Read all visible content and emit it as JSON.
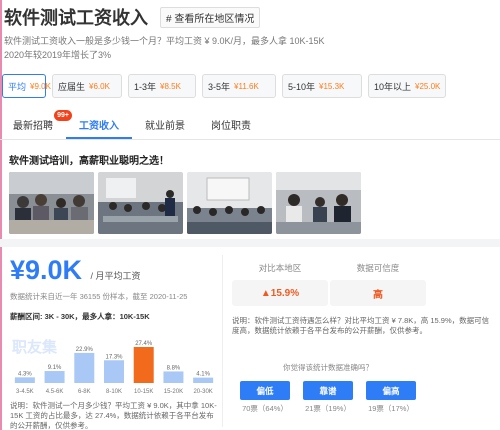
{
  "header": {
    "title": "软件测试工资收入",
    "region_button": "# 查看所在地区情况",
    "summary": "软件测试工资收入一般是多少钱一个月？平均工资 ¥ 9.0K/月，最多人拿 10K-15K",
    "growth": "2020年较2019年增长了3%"
  },
  "filters": [
    {
      "label": "平均",
      "value": "¥9.0K",
      "active": true
    },
    {
      "label": "应届生",
      "value": "¥6.0K"
    },
    {
      "label": "1-3年",
      "value": "¥8.5K"
    },
    {
      "label": "3-5年",
      "value": "¥11.6K"
    },
    {
      "label": "5-10年",
      "value": "¥15.3K"
    },
    {
      "label": "10年以上",
      "value": "¥25.0K"
    }
  ],
  "tabs": [
    {
      "label": "最新招聘",
      "badge": "99+"
    },
    {
      "label": "工资收入",
      "active": true
    },
    {
      "label": "就业前景"
    },
    {
      "label": "岗位职责"
    }
  ],
  "promo": {
    "title": "软件测试培训，高薪职业聪明之选！"
  },
  "salary": {
    "amount": "¥9.0K",
    "unit": "/ 月平均工资",
    "stats": "数据统计来自近一年 36155 份样本，截至 2020-11-25",
    "range": "薪酬区间: 3K - 30K，最多人拿：10K-15K",
    "watermark": "职友集"
  },
  "chart_data": {
    "type": "bar",
    "categories": [
      "3-4.5K",
      "4.5-6K",
      "6-8K",
      "8-10K",
      "10-15K",
      "15-20K",
      "20-30K"
    ],
    "values": [
      4.3,
      9.1,
      22.9,
      17.3,
      27.4,
      8.8,
      4.1
    ],
    "value_labels": [
      "4.3%",
      "9.1%",
      "22.9%",
      "17.3%",
      "27.4%",
      "8.8%",
      "4.1%"
    ],
    "highlight_index": 4,
    "colors": {
      "normal": "#a9c8f5",
      "highlight": "#f26b1d"
    }
  },
  "left_note": "说明：软件测试一个月多少钱？平均工资 ¥ 9.0K，其中拿 10K-15K 工资的占比最多，达 27.4%，数据统计依赖于各平台发布的公开薪酬，仅供参考。",
  "comparison": {
    "left_label": "对比本地区",
    "left_value": "▲15.9%",
    "right_label": "数据可信度",
    "right_value": "高"
  },
  "right_note": "说明：软件测试工资待遇怎么样？对比平均工资 ¥ 7.8K，高 15.9%，数据可信度高，数据统计依赖于各平台发布的公开薪酬，仅供参考。",
  "vote": {
    "question": "你觉得该统计数据准确吗？",
    "options": [
      {
        "label": "偏低",
        "count": "70票（64%）"
      },
      {
        "label": "靠谱",
        "count": "21票（19%）"
      },
      {
        "label": "偏高",
        "count": "19票（17%）"
      }
    ]
  }
}
